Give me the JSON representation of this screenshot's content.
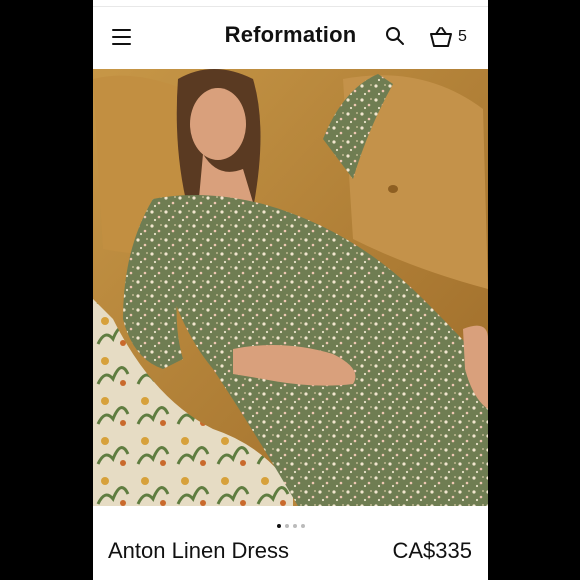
{
  "header": {
    "brand": "Reformation",
    "menu_icon": "hamburger-menu-icon",
    "search_icon": "search-icon",
    "cart_icon": "shopping-basket-icon",
    "cart_count": "5"
  },
  "gallery": {
    "photo_alt": "Model lying on a mustard velvet sofa wearing a green floral long-sleeve dress",
    "dots_total": 4,
    "active_index": 0
  },
  "product": {
    "name": "Anton Linen Dress",
    "price": "CA$335"
  },
  "colors": {
    "background": "#000000",
    "sofa": "#b9853b",
    "dress": "#6f7d52",
    "text": "#111111"
  }
}
